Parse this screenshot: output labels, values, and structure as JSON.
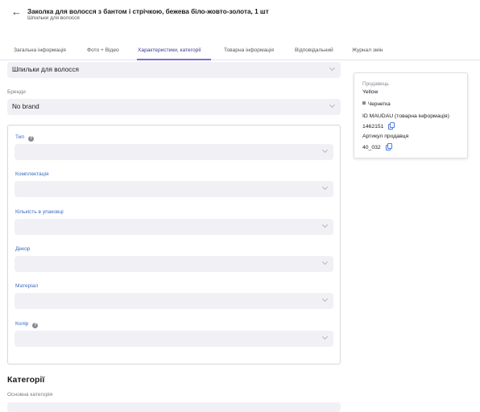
{
  "header": {
    "back_icon": "arrow-left-icon",
    "title": "Заколка для волосся з бантом і стрічкою, бежева біло-жовто-золота, 1 шт",
    "subtitle": "Шпильки для волосся"
  },
  "tabs": [
    {
      "label": "Загальна інформація"
    },
    {
      "label": "Фото + Відео"
    },
    {
      "label": "Характеристики, категорії",
      "active": true
    },
    {
      "label": "Товарна інформація"
    },
    {
      "label": "Відповідальний"
    },
    {
      "label": "Журнал змін"
    }
  ],
  "top_select": {
    "value": "Шпильки для волосся"
  },
  "brand": {
    "label": "Бренди",
    "value": "No brand"
  },
  "attributes": [
    {
      "label": "Тип",
      "value": "",
      "has_help": true
    },
    {
      "label": "Комплектація",
      "value": ""
    },
    {
      "label": "Кількість в упаковці",
      "value": ""
    },
    {
      "label": "Декор",
      "value": ""
    },
    {
      "label": "Матеріал",
      "value": ""
    },
    {
      "label": "Колір",
      "value": "",
      "has_help": true
    }
  ],
  "categories": {
    "title": "Категорії",
    "main_label": "Основна категорія"
  },
  "info_card": {
    "seller_label": "Продавець",
    "seller_value": "Yellow",
    "status": "Чернетка",
    "id_label": "ID MAUDAU (товарна інформація)",
    "id_value": "1462151",
    "sku_label": "Артикул продавця",
    "sku_value": "40_032"
  },
  "colors": {
    "accent": "#7b6cd9",
    "attr_label": "#3b6dbf",
    "field_bg": "#f1f1f5",
    "copy_icon": "#4a7de0"
  }
}
